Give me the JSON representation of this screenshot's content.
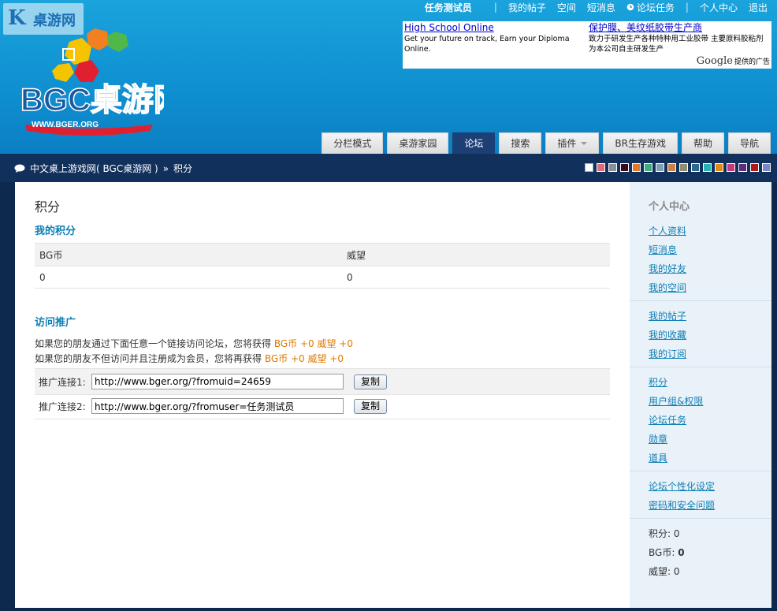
{
  "watermark": {
    "glyph": "K",
    "text": "桌游网"
  },
  "logo": {
    "text": "BGC桌游网",
    "url_text": "WWW.BGER.ORG"
  },
  "topnav": {
    "username": "任务测试员",
    "items": [
      "我的帖子",
      "空间",
      "短消息",
      "论坛任务",
      "个人中心",
      "退出"
    ]
  },
  "ad": {
    "ad1_title": "High School Online",
    "ad1_body": "Get your future on track, Earn your Diploma Online.",
    "ad2_title": "保护膜、美纹纸胶带生产商",
    "ad2_body": "致力于研发生产各种特种用工业胶带 主要原料胶粘剂为本公司自主研发生产",
    "google_brand": "Google",
    "google_suffix": "提供的广告"
  },
  "nav_tabs": [
    "分栏模式",
    "桌游家园",
    "论坛",
    "搜索",
    "插件",
    "BR生存游戏",
    "帮助",
    "导航"
  ],
  "breadcrumb": {
    "site": "中文桌上游戏网( BGC桌游网 )",
    "separator": "»",
    "current": "积分"
  },
  "swatch_colors": [
    "#ffffff",
    "#e06b7d",
    "#8a8f9c",
    "#3a0b18",
    "#e07a2a",
    "#3fae7c",
    "#7f9fb6",
    "#c8824a",
    "#8f8f6f",
    "#2e6a8a",
    "#2ab2b2",
    "#e08a1a",
    "#c43a7a",
    "#5b2d7a",
    "#b21a1a",
    "#7f86c8"
  ],
  "main": {
    "heading": "积分",
    "my_credits_title": "我的积分",
    "credits_headers": [
      "BG币",
      "威望"
    ],
    "credits_values": [
      "0",
      "0"
    ],
    "promo_title": "访问推广",
    "promo_line1_prefix": "如果您的朋友通过下面任意一个链接访问论坛，您将获得",
    "promo_line1_reward": "BG币 +0 威望 +0",
    "promo_line2_prefix": "如果您的朋友不但访问并且注册成为会员，您将再获得",
    "promo_line2_reward": "BG币 +0 威望 +0",
    "link1_label": "推广连接1:",
    "link1_value": "http://www.bger.org/?fromuid=24659",
    "link2_label": "推广连接2:",
    "link2_value": "http://www.bger.org/?fromuser=任务测试员",
    "copy_label": "复制"
  },
  "sidebar": {
    "title": "个人中心",
    "groups": [
      [
        "个人资料",
        "短消息",
        "我的好友",
        "我的空间"
      ],
      [
        "我的帖子",
        "我的收藏",
        "我的订阅"
      ],
      [
        "积分",
        "用户组&权限",
        "论坛任务",
        "勋章",
        "道具"
      ],
      [
        "论坛个性化设定",
        "密码和安全问题"
      ]
    ],
    "stats": [
      {
        "label": "积分:",
        "value": "0"
      },
      {
        "label": "BG币:",
        "value": "0"
      },
      {
        "label": "威望:",
        "value": "0"
      }
    ]
  }
}
